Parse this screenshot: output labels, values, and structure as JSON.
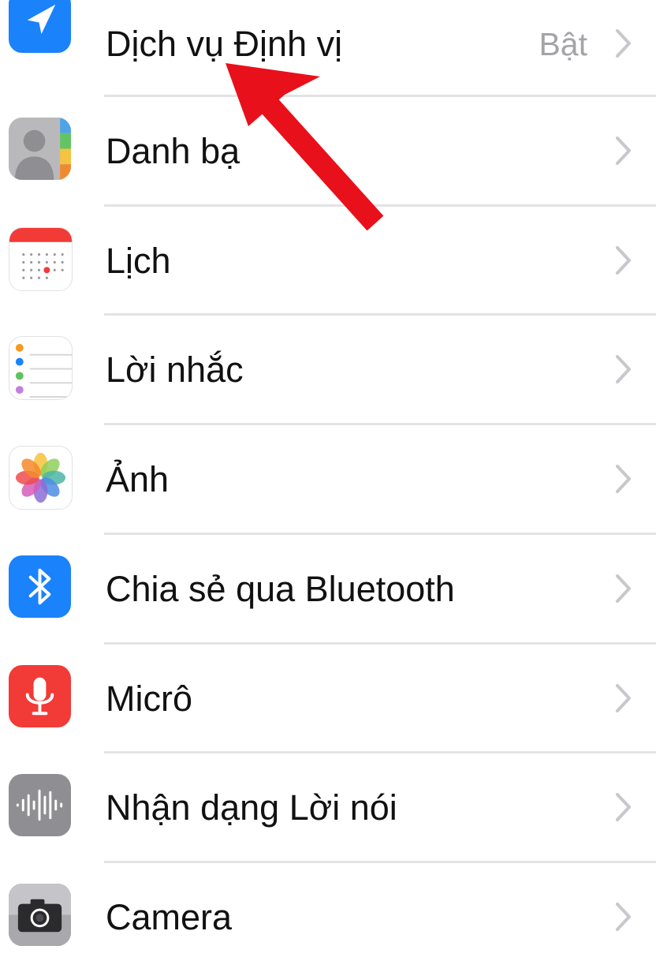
{
  "settings": {
    "items": [
      {
        "label": "Dịch vụ Định vị",
        "value": "Bật",
        "icon": "location-arrow-icon",
        "icon_color": "#1a82fb"
      },
      {
        "label": "Danh bạ",
        "value": "",
        "icon": "contacts-icon",
        "icon_color": "#a9a9a9"
      },
      {
        "label": "Lịch",
        "value": "",
        "icon": "calendar-icon",
        "icon_color": "#ff3b30"
      },
      {
        "label": "Lời nhắc",
        "value": "",
        "icon": "reminders-icon",
        "icon_color": "#ffffff"
      },
      {
        "label": "Ảnh",
        "value": "",
        "icon": "photos-icon",
        "icon_color": "#ffffff"
      },
      {
        "label": "Chia sẻ qua Bluetooth",
        "value": "",
        "icon": "bluetooth-icon",
        "icon_color": "#1a82fb"
      },
      {
        "label": "Micrô",
        "value": "",
        "icon": "microphone-icon",
        "icon_color": "#f23a37"
      },
      {
        "label": "Nhận dạng Lời nói",
        "value": "",
        "icon": "speech-waveform-icon",
        "icon_color": "#8e8e93"
      },
      {
        "label": "Camera",
        "value": "",
        "icon": "camera-icon",
        "icon_color": "#8e8e93"
      }
    ]
  },
  "annotation": {
    "arrow_color": "#e8101a",
    "arrow_icon": "red-pointer-arrow-icon"
  }
}
